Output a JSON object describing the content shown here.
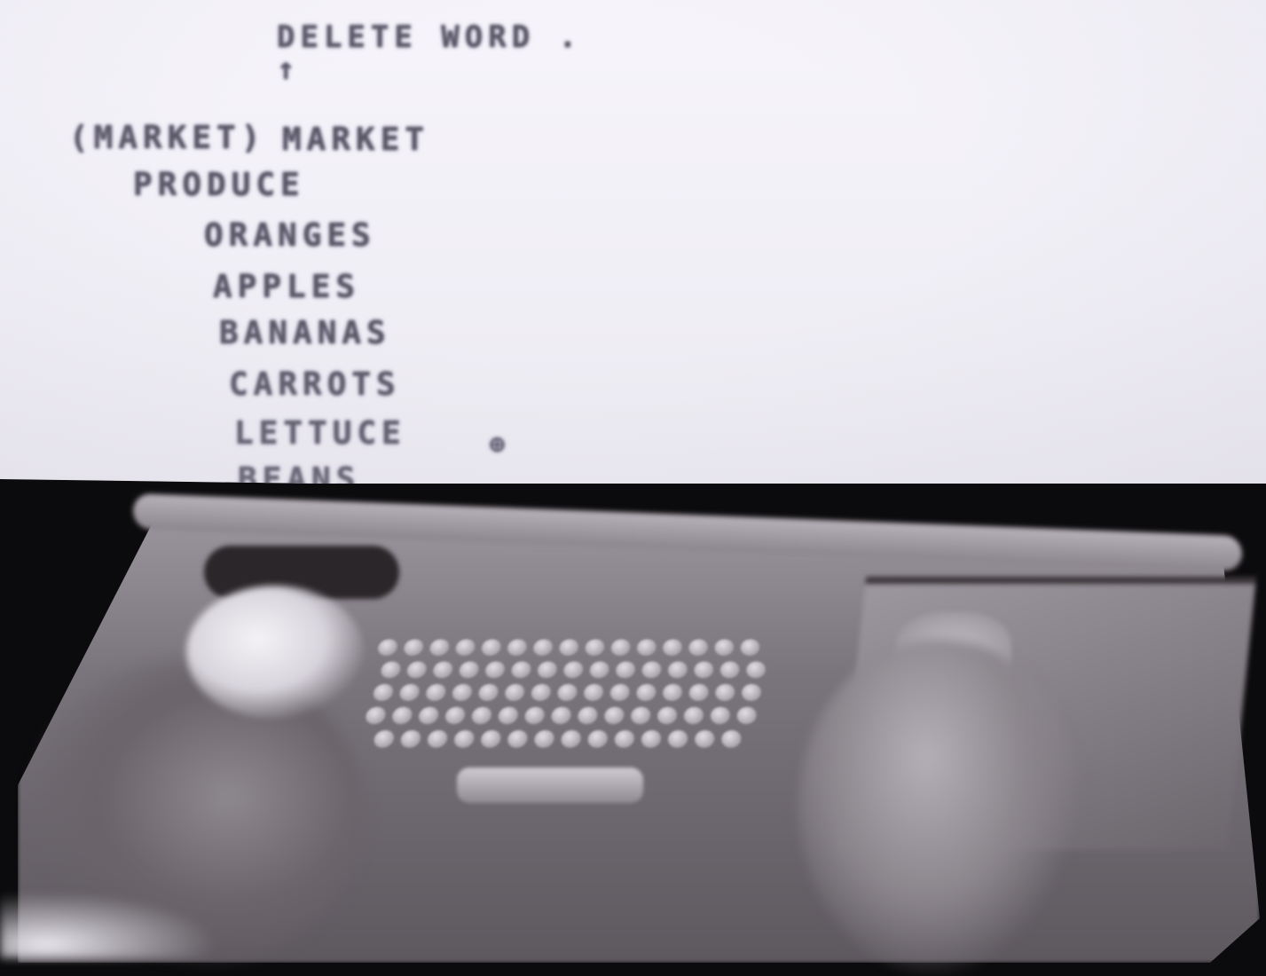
{
  "screen": {
    "command": "DELETE WORD .",
    "prompt": "↑",
    "header": {
      "label": "(MARKET)",
      "title": "MARKET"
    },
    "items": [
      "PRODUCE",
      "ORANGES",
      "APPLES",
      "BANANAS",
      "CARROTS",
      "LETTUCE"
    ],
    "cut_off_item": "BEANS",
    "cursor": "⊕"
  },
  "palette": {
    "screen_bg": "#f4f2f8",
    "text": "#5a5766",
    "hardware": "#7a747c"
  },
  "icons": [
    "keyset-icon",
    "keyboard-icon",
    "mouse-icon",
    "cursor-icon"
  ]
}
